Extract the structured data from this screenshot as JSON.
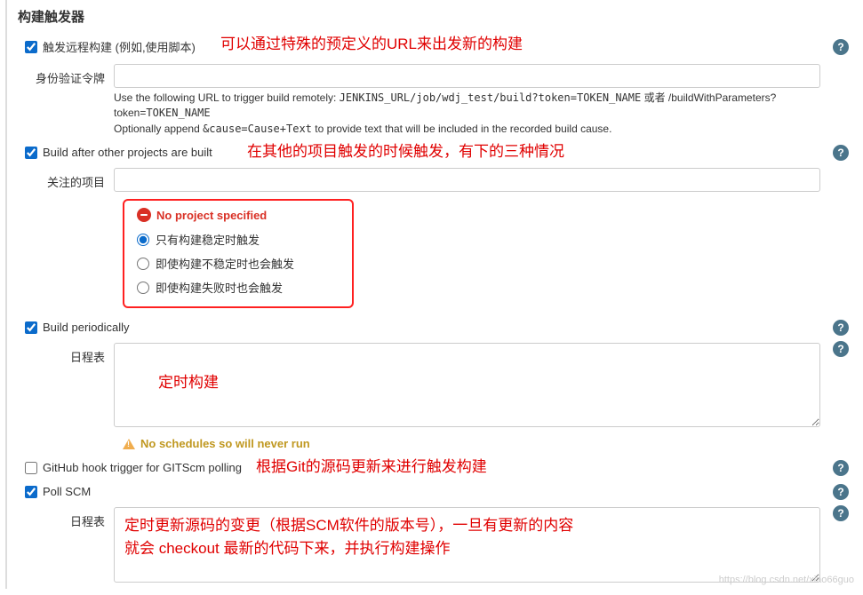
{
  "title": "构建触发器",
  "triggers": {
    "remote": {
      "checked": true,
      "label": "触发远程构建 (例如,使用脚本)",
      "annotation": "可以通过特殊的预定义的URL来出发新的构建",
      "token_label": "身份验证令牌",
      "token_value": "",
      "desc_line1_prefix": "Use the following URL to trigger build remotely: ",
      "desc_line1_code": "JENKINS_URL/job/wdj_test/build?token=TOKEN_NAME",
      "desc_line1_mid": " 或者 /buildWithParameters?token=",
      "desc_line1_code2": "TOKEN_NAME",
      "desc_line2_prefix": "Optionally append ",
      "desc_line2_code": "&cause=Cause+Text",
      "desc_line2_suffix": " to provide text that will be included in the recorded build cause."
    },
    "after_build": {
      "checked": true,
      "label": "Build after other projects are built",
      "annotation": "在其他的项目触发的时候触发，有下的三种情况",
      "watch_label": "关注的项目",
      "watch_value": "",
      "error": "No project specified",
      "radio1": "只有构建稳定时触发",
      "radio2": "即使构建不稳定时也会触发",
      "radio3": "即使构建失败时也会触发"
    },
    "periodic": {
      "checked": true,
      "label": "Build periodically",
      "schedule_label": "日程表",
      "schedule_value": "",
      "annotation": "定时构建",
      "warning": "No schedules so will never run"
    },
    "github_hook": {
      "checked": false,
      "label": "GitHub hook trigger for GITScm polling",
      "annotation": "根据Git的源码更新来进行触发构建"
    },
    "poll_scm": {
      "checked": true,
      "label": "Poll SCM",
      "schedule_label": "日程表",
      "schedule_value": "",
      "annotation_line1": "定时更新源码的变更（根据SCM软件的版本号），一旦有更新的内容",
      "annotation_line2": "就会 checkout 最新的代码下来，并执行构建操作"
    }
  },
  "watermark": "https://blog.csdn.net/xiao66guo"
}
